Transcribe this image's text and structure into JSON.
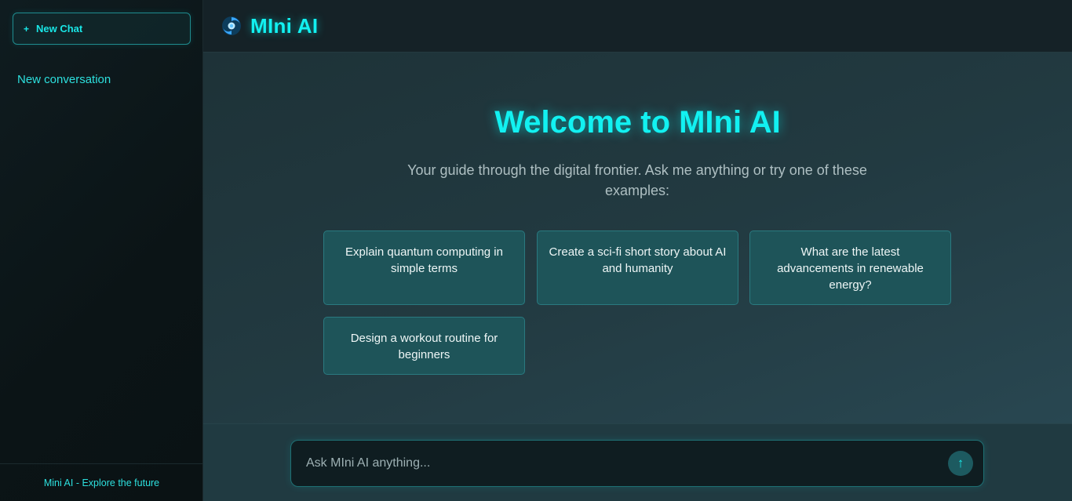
{
  "sidebar": {
    "new_chat_label": "New Chat",
    "plus_icon": "+",
    "conversations": [
      {
        "label": "New conversation"
      }
    ],
    "footer": "Mini AI - Explore the future"
  },
  "header": {
    "brand": "MIni AI",
    "logo_icon": "swirl-logo-icon"
  },
  "main": {
    "welcome_title": "Welcome to MIni AI",
    "welcome_subtitle": "Your guide through the digital frontier. Ask me anything or try one of these examples:",
    "examples": [
      {
        "text": "Explain quantum computing in simple terms"
      },
      {
        "text": "Create a sci-fi short story about AI and humanity"
      },
      {
        "text": "What are the latest advancements in renewable energy?"
      },
      {
        "text": "Design a workout routine for beginners"
      }
    ]
  },
  "input": {
    "placeholder": "Ask MIni AI anything...",
    "send_icon": "↑"
  },
  "colors": {
    "accent": "#12f1f1",
    "card_bg": "#1e5459",
    "sidebar_bg": "#0b1416",
    "main_bg": "#223a41"
  }
}
